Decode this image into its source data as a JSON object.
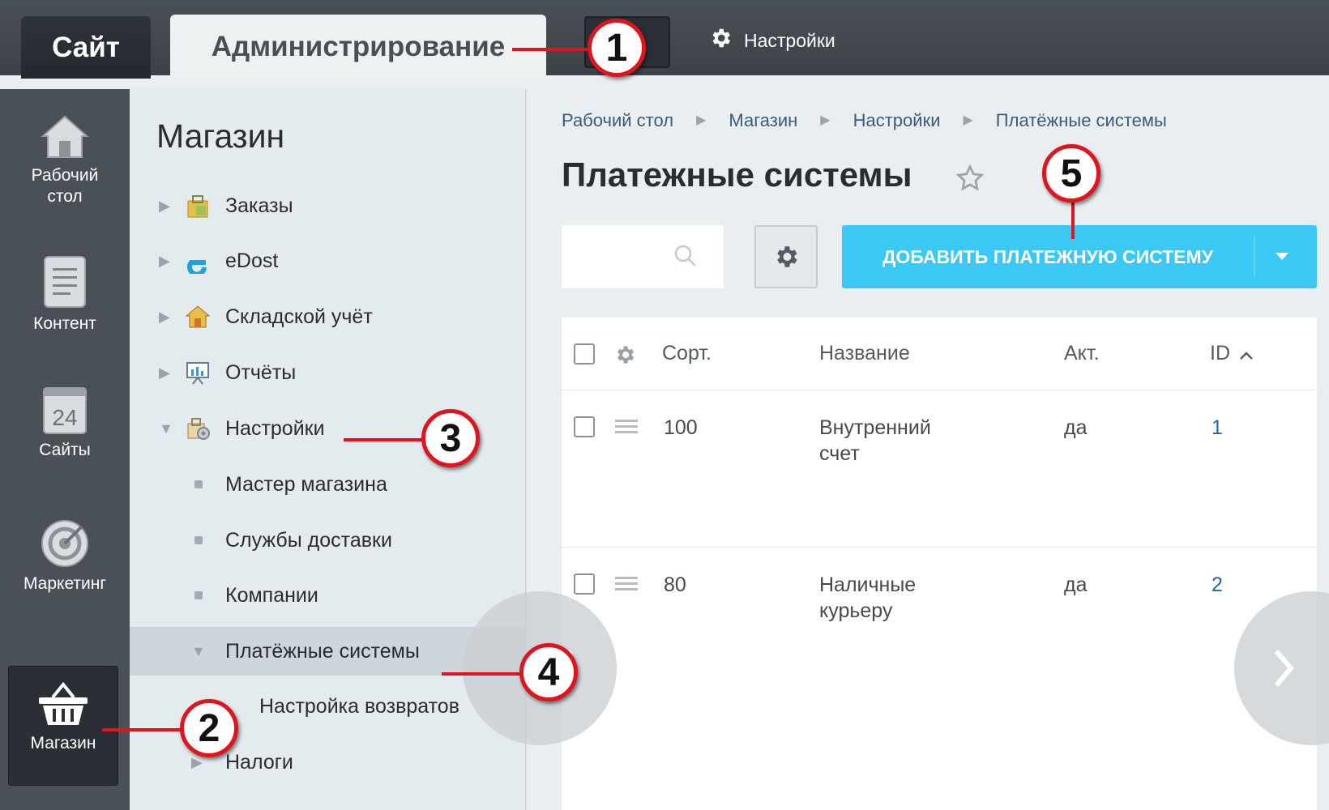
{
  "topbar": {
    "tab_site": "Сайт",
    "tab_admin": "Администрирование",
    "settings_label": "Настройки",
    "settings_icon": "gear-icon"
  },
  "rail": {
    "items": [
      {
        "label": "Рабочий\nстол",
        "icon": "house-icon"
      },
      {
        "label": "Контент",
        "icon": "document-icon"
      },
      {
        "label": "Сайты",
        "icon": "calendar-24-icon"
      },
      {
        "label": "Маркетинг",
        "icon": "target-icon"
      },
      {
        "label": "Магазин",
        "icon": "basket-icon",
        "active": true
      }
    ]
  },
  "menu": {
    "title": "Магазин",
    "items": [
      {
        "label": "Заказы",
        "icon": "shopping-bag-icon",
        "expanded": false
      },
      {
        "label": "eDost",
        "icon": "edost-logo-icon",
        "expanded": false
      },
      {
        "label": "Складской учёт",
        "icon": "warehouse-icon",
        "expanded": false
      },
      {
        "label": "Отчёты",
        "icon": "presentation-board-icon",
        "expanded": false
      },
      {
        "label": "Настройки",
        "icon": "settings-bag-icon",
        "expanded": true
      },
      {
        "label": "Мастер магазина"
      },
      {
        "label": "Службы доставки"
      },
      {
        "label": "Компании"
      },
      {
        "label": "Платёжные системы",
        "expanded": true,
        "active": true
      },
      {
        "label": "Настройка возвратов"
      },
      {
        "label": "Налоги",
        "expanded": false
      }
    ]
  },
  "breadcrumbs": [
    "Рабочий стол",
    "Магазин",
    "Настройки",
    "Платёжные системы"
  ],
  "page": {
    "title": "Платежные системы",
    "add_button_label": "ДОБАВИТЬ ПЛАТЕЖНУЮ СИСТЕМУ",
    "search_placeholder": ""
  },
  "table": {
    "columns": [
      "Сорт.",
      "Название",
      "Акт.",
      "ID"
    ],
    "sort_column": "ID",
    "sort_direction": "asc",
    "rows": [
      {
        "sort": "100",
        "name": "Внутренний\nсчет",
        "active": "да",
        "id": "1"
      },
      {
        "sort": "80",
        "name": "Наличные\nкурьеру",
        "active": "да",
        "id": "2"
      }
    ]
  },
  "annotations": [
    "1",
    "2",
    "3",
    "4",
    "5"
  ],
  "colors": {
    "accent": "#3bc8f5",
    "callout_red": "#e0141e",
    "link": "#2067b0",
    "topbar": "#41464c"
  }
}
